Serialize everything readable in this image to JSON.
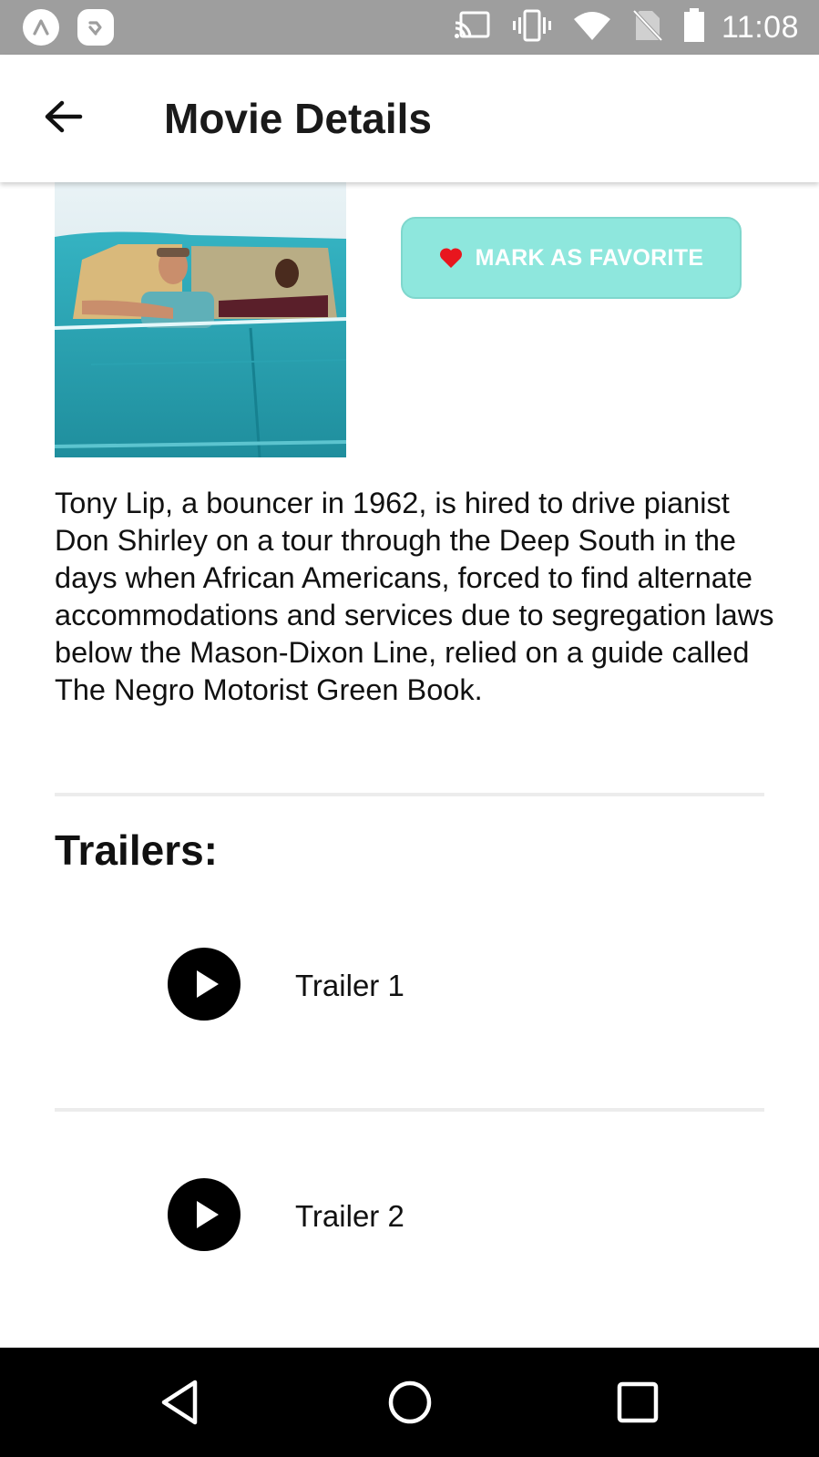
{
  "status_bar": {
    "time": "11:08",
    "icons": [
      "app-a-icon",
      "notification-app-icon",
      "cast-icon",
      "vibrate-icon",
      "wifi-icon",
      "no-sim-icon",
      "battery-icon"
    ]
  },
  "app_bar": {
    "title": "Movie Details",
    "back_icon": "arrow-back-icon"
  },
  "movie": {
    "poster_description_icon": "movie-poster",
    "favorite_button_label": "MARK AS FAVORITE",
    "favorite_icon": "heart-icon",
    "overview": "Tony Lip, a bouncer in 1962, is hired to drive pianist Don Shirley on a tour through the Deep South in the days when African Americans, forced to find alternate accommodations and services due to segregation laws below the Mason-Dixon Line, relied on a guide called The Negro Motorist Green Book."
  },
  "trailers": {
    "heading": "Trailers:",
    "items": [
      {
        "label": "Trailer 1",
        "icon": "play-icon"
      },
      {
        "label": "Trailer 2",
        "icon": "play-icon"
      }
    ]
  },
  "nav_bar": {
    "buttons": [
      "back-triangle-icon",
      "home-circle-icon",
      "recents-square-icon"
    ]
  },
  "colors": {
    "status_bar_bg": "#9e9e9e",
    "favorite_bg": "#8ee7dd",
    "heart": "#e8161e",
    "nav_bar_bg": "#000000"
  }
}
